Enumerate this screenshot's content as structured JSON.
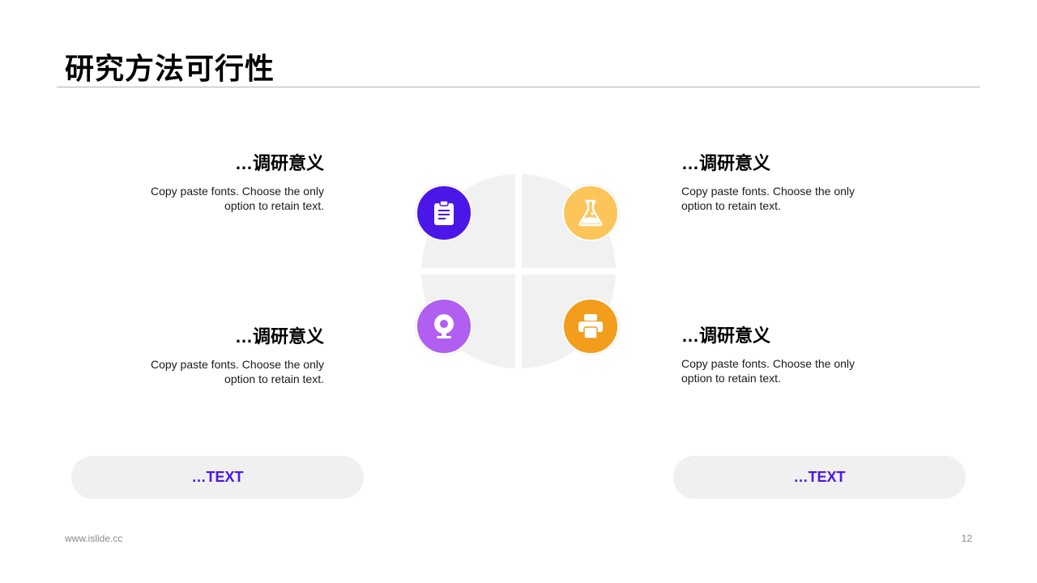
{
  "title": "研究方法可行性",
  "blocks": [
    {
      "heading": "…调研意义",
      "body": "Copy paste fonts. Choose the only option to retain text."
    },
    {
      "heading": "…调研意义",
      "body": "Copy paste fonts. Choose the only option to retain text."
    },
    {
      "heading": "…调研意义",
      "body": "Copy paste fonts. Choose the only option to retain text."
    },
    {
      "heading": "…调研意义",
      "body": "Copy paste fonts. Choose the only option to retain text."
    }
  ],
  "icons": [
    {
      "name": "clipboard-icon",
      "color": "#4a17e8"
    },
    {
      "name": "flask-icon",
      "color": "#fcc55a"
    },
    {
      "name": "webcam-icon",
      "color": "#b05ff0"
    },
    {
      "name": "printer-icon",
      "color": "#f29d1b"
    }
  ],
  "pills": [
    {
      "label": "…TEXT"
    },
    {
      "label": "…TEXT"
    }
  ],
  "colors": {
    "accent": "#4a17e8",
    "segment": "#f1f1f1",
    "pill_bg": "#f0f0f0"
  },
  "footer": {
    "website": "www.islide.cc",
    "page_number": "12"
  }
}
